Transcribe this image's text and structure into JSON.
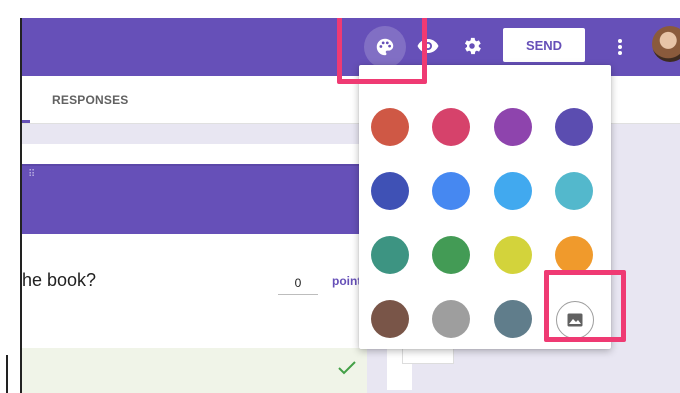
{
  "tabs": {
    "responses": "RESPONSES"
  },
  "toolbar": {
    "send_label": "SEND"
  },
  "question": {
    "text": "he book?",
    "points_value": "0",
    "points_label": "point"
  },
  "icons": {
    "palette": "palette-icon",
    "preview": "eye-icon",
    "settings": "gear-icon",
    "more": "more-vert-icon",
    "image": "image-icon",
    "check": "check-icon",
    "drag": "drag-handle-icon"
  },
  "theme": {
    "accent": "#6650b8",
    "highlight": "#ef3a73"
  },
  "palette": {
    "colors": [
      "#cf5845",
      "#d6426b",
      "#8e44ad",
      "#5b4db0",
      "#3f51b5",
      "#4688f1",
      "#41a9ef",
      "#53b8cc",
      "#3d9482",
      "#439b55",
      "#d3d33b",
      "#f09a2c",
      "#795548",
      "#9e9e9e",
      "#607d8b"
    ]
  }
}
